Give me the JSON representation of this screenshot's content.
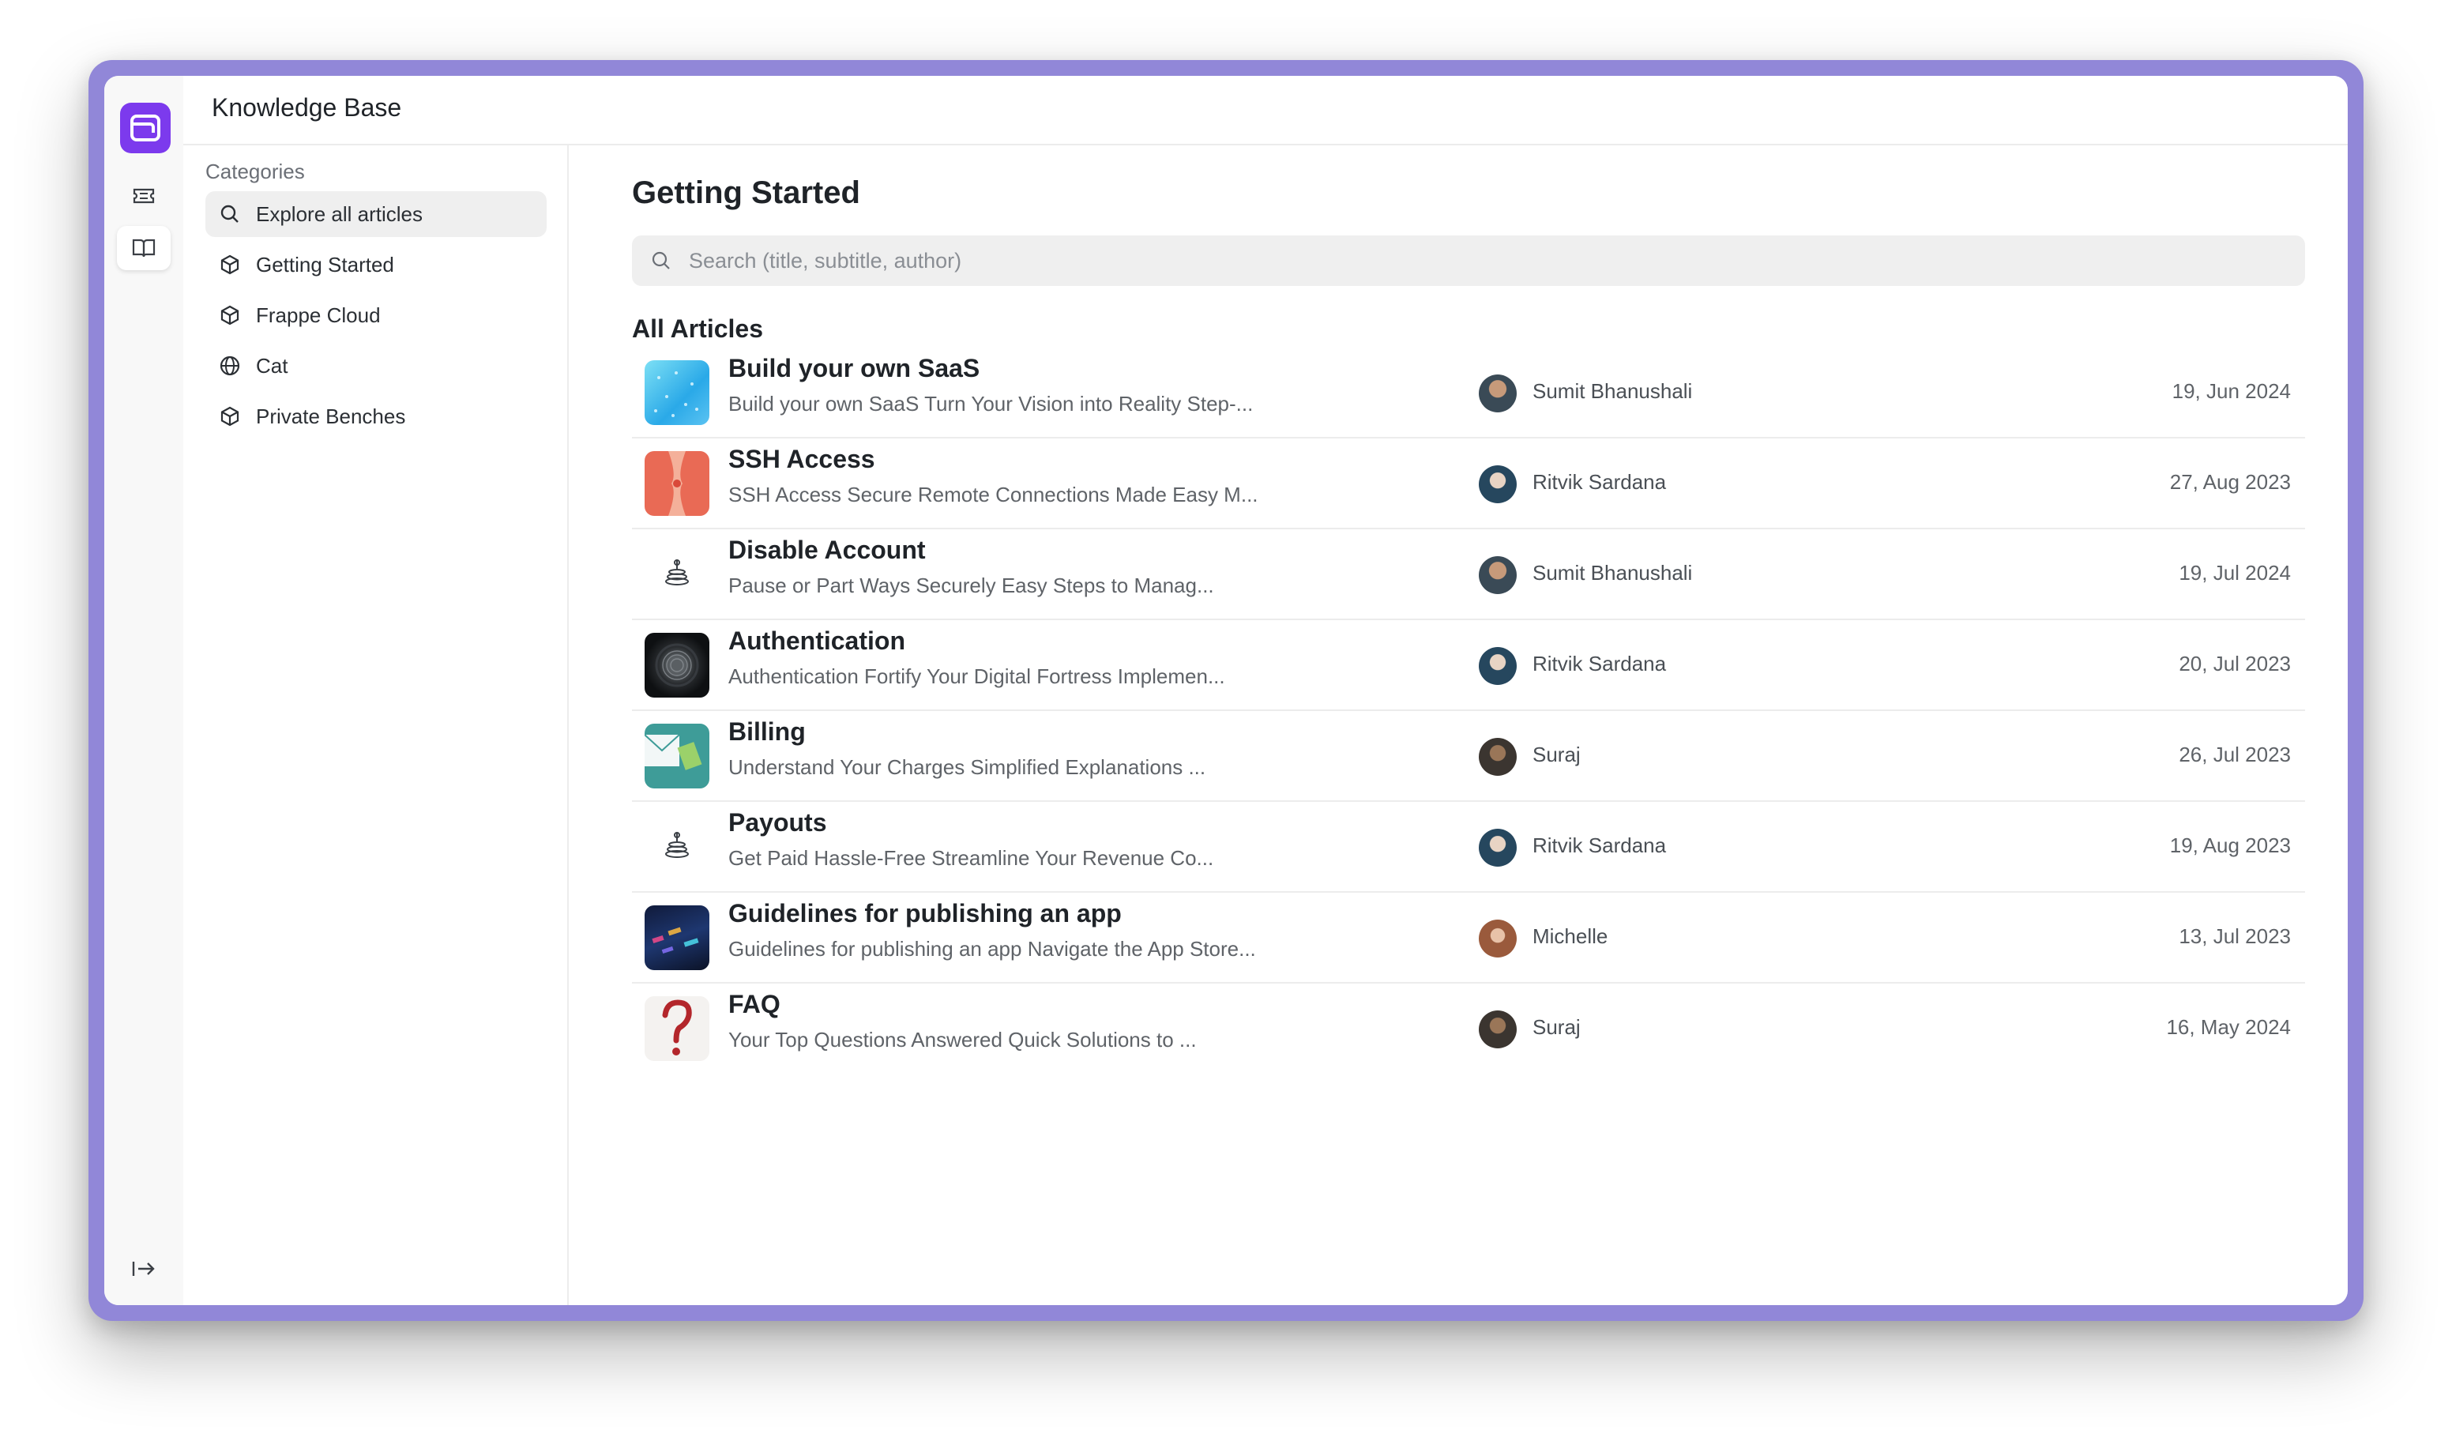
{
  "app": {
    "title": "Knowledge Base"
  },
  "categories": {
    "heading": "Categories",
    "items": [
      {
        "label": "Explore all articles",
        "icon": "search-icon"
      },
      {
        "label": "Getting Started",
        "icon": "cube-icon"
      },
      {
        "label": "Frappe Cloud",
        "icon": "cube-icon"
      },
      {
        "label": "Cat",
        "icon": "globe-icon"
      },
      {
        "label": "Private Benches",
        "icon": "cube-icon"
      }
    ]
  },
  "main": {
    "title": "Getting Started",
    "search_placeholder": "Search (title, subtitle, author)",
    "section_title": "All Articles"
  },
  "articles": [
    {
      "title": "Build your own SaaS",
      "subtitle": "Build your own SaaS Turn Your Vision into Reality Step-...",
      "author": "Sumit Bhanushali",
      "date": "19, Jun 2024"
    },
    {
      "title": "SSH Access",
      "subtitle": "SSH Access Secure Remote Connections Made Easy M...",
      "author": "Ritvik Sardana",
      "date": "27, Aug 2023"
    },
    {
      "title": "Disable Account",
      "subtitle": "Pause or Part Ways Securely Easy Steps to Manag...",
      "author": "Sumit Bhanushali",
      "date": "19, Jul 2024"
    },
    {
      "title": "Authentication",
      "subtitle": "Authentication Fortify Your Digital Fortress Implemen...",
      "author": "Ritvik Sardana",
      "date": "20, Jul 2023"
    },
    {
      "title": "Billing",
      "subtitle": "Understand Your Charges Simplified Explanations ...",
      "author": "Suraj",
      "date": "26, Jul 2023"
    },
    {
      "title": "Payouts",
      "subtitle": "Get Paid Hassle-Free Streamline Your Revenue Co...",
      "author": "Ritvik Sardana",
      "date": "19, Aug 2023"
    },
    {
      "title": "Guidelines for publishing an app",
      "subtitle": "Guidelines for publishing an app Navigate the App Store...",
      "author": "Michelle",
      "date": "13, Jul 2023"
    },
    {
      "title": "FAQ",
      "subtitle": "Your Top Questions Answered Quick Solutions to ...",
      "author": "Suraj",
      "date": "16, May 2024"
    }
  ],
  "colors": {
    "accent": "#7c3aed",
    "frame": "#9187d8"
  }
}
